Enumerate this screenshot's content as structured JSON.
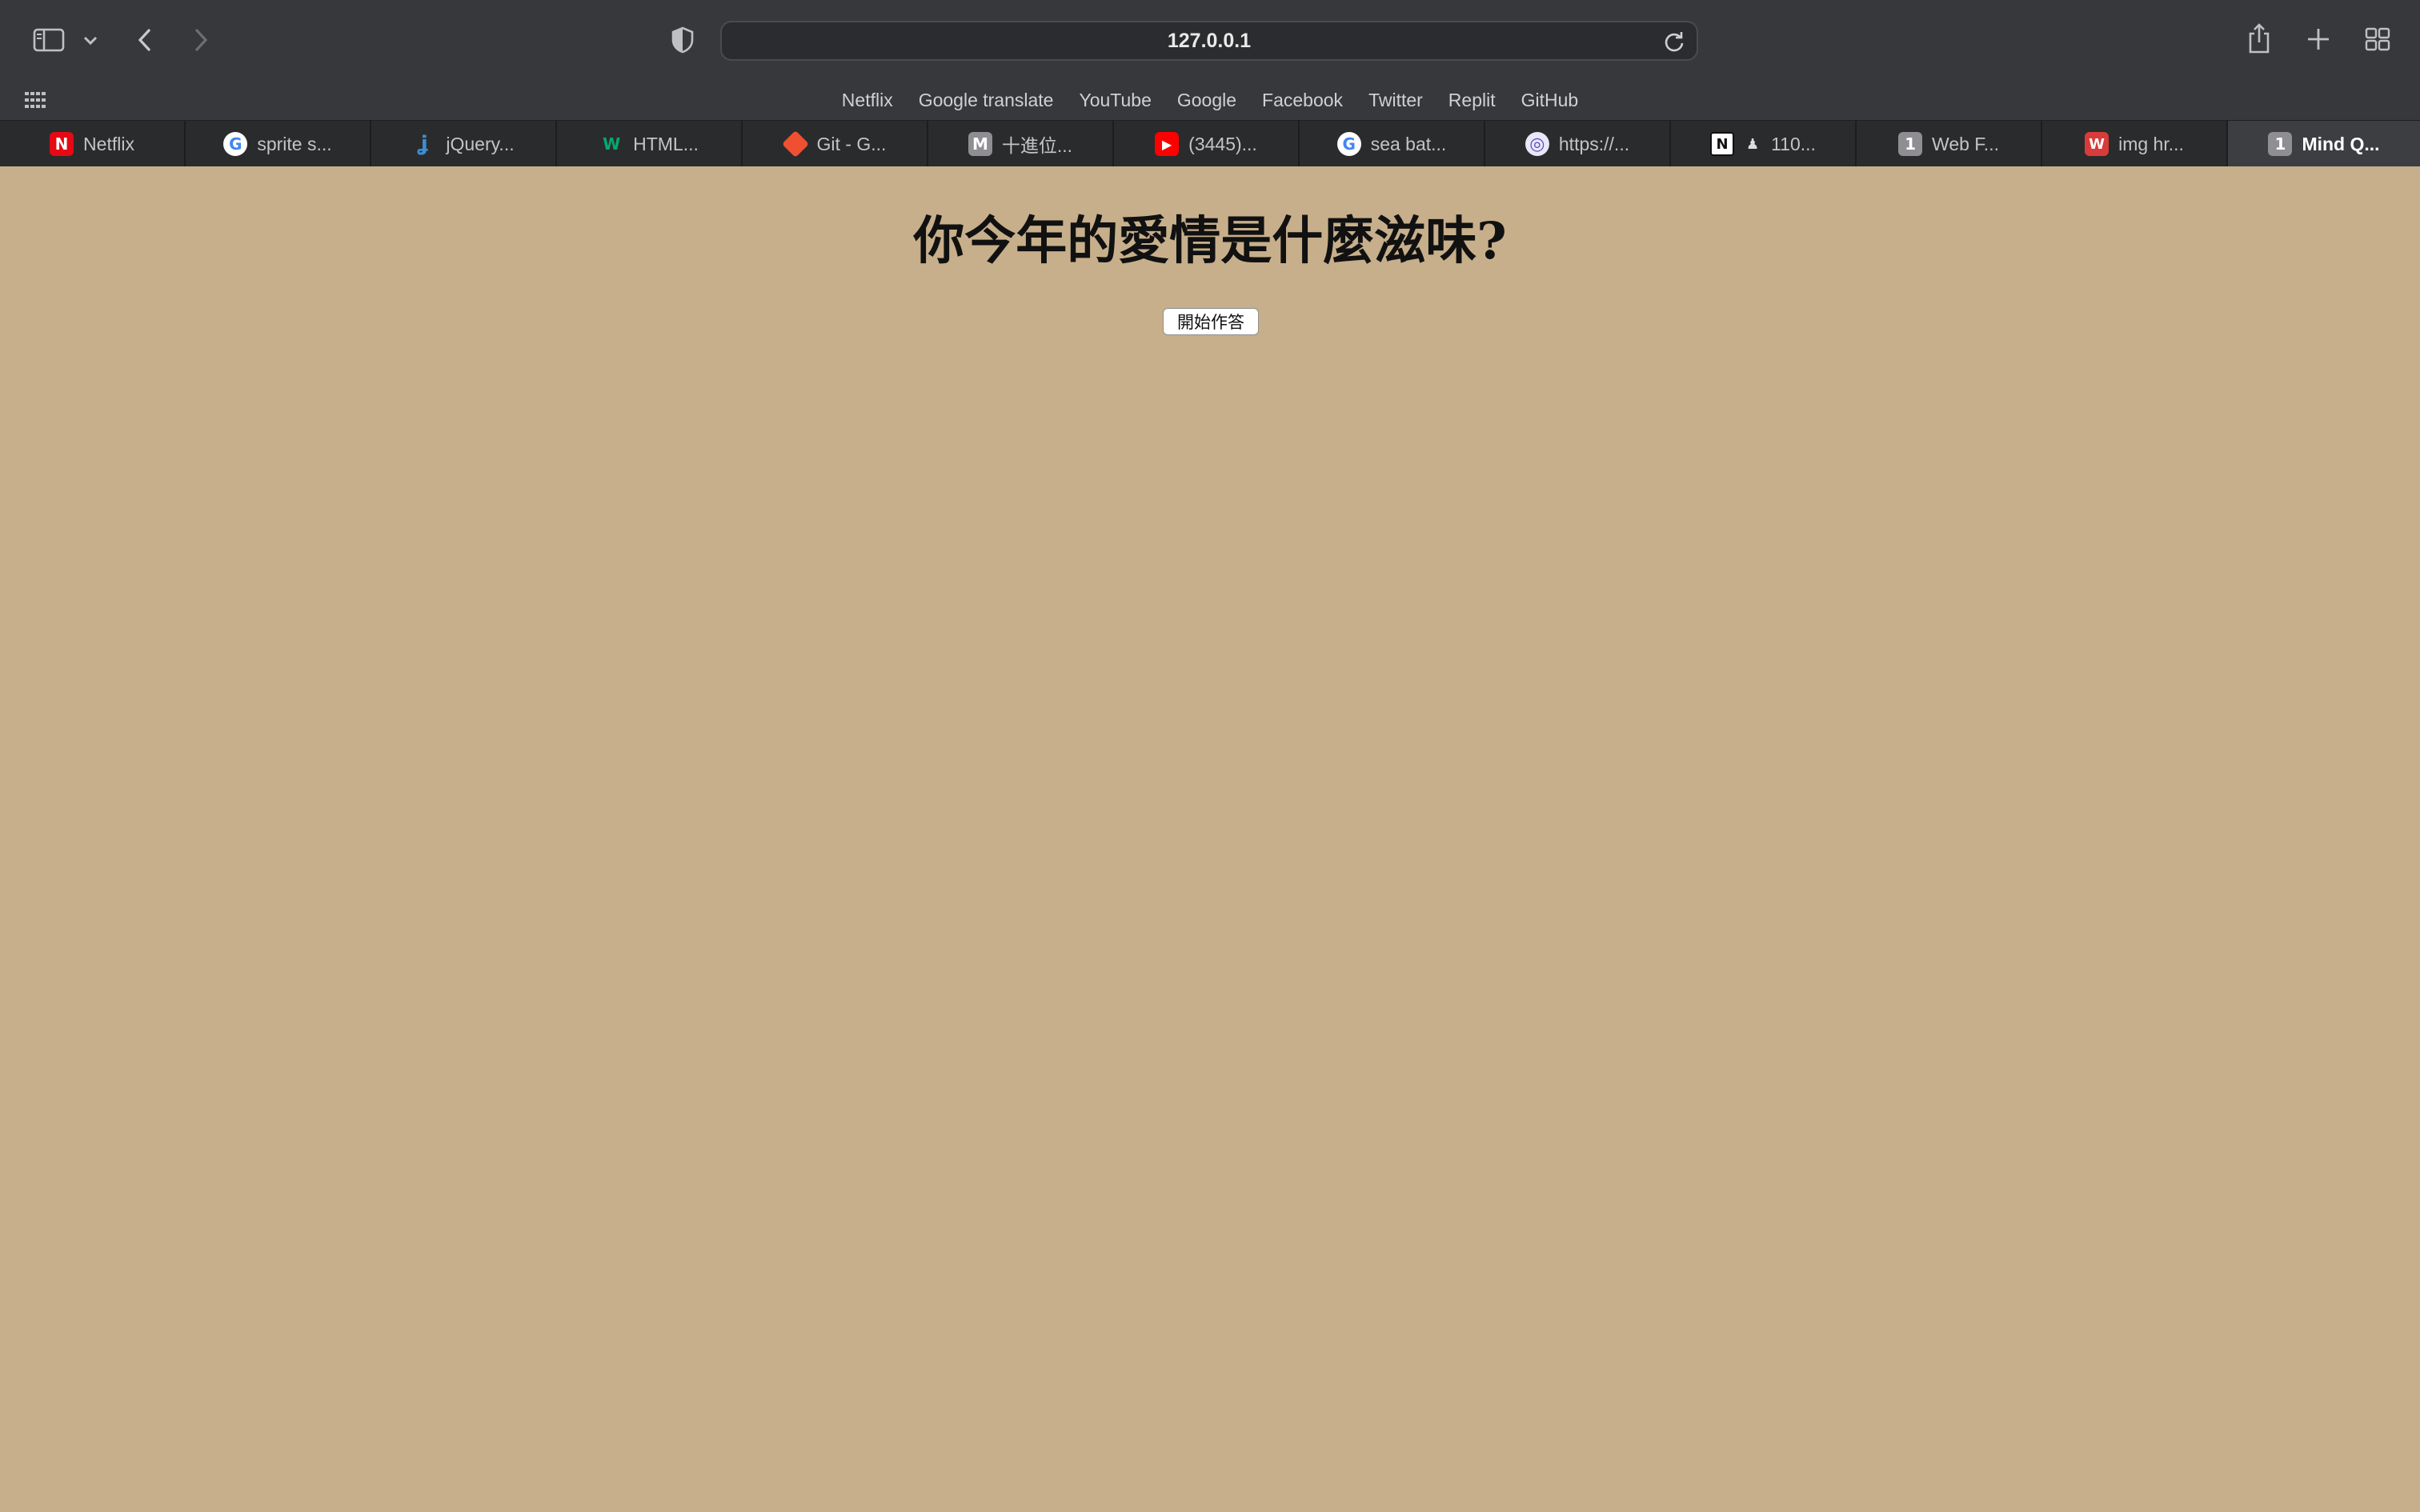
{
  "browser": {
    "address": "127.0.0.1",
    "favorites": [
      "Netflix",
      "Google translate",
      "YouTube",
      "Google",
      "Facebook",
      "Twitter",
      "Replit",
      "GitHub"
    ],
    "tabs": [
      {
        "label": "Netflix",
        "icon": "netflix-icon",
        "color": "#e50914",
        "glyph": "N"
      },
      {
        "label": "sprite s...",
        "icon": "google-icon",
        "color": "#ffffff",
        "glyph": "G"
      },
      {
        "label": "jQuery...",
        "icon": "jquery-icon",
        "color": "#2a2b2d",
        "glyph": "j"
      },
      {
        "label": "HTML...",
        "icon": "w3schools-icon",
        "color": "#2a2b2d",
        "glyph": "W"
      },
      {
        "label": "Git - G...",
        "icon": "git-icon",
        "color": "#f05032",
        "glyph": "◆"
      },
      {
        "label": "十進位...",
        "icon": "medium-icon",
        "color": "#8e8e93",
        "glyph": "M"
      },
      {
        "label": "(3445)...",
        "icon": "youtube-icon",
        "color": "#ff0000",
        "glyph": "▶"
      },
      {
        "label": "sea bat...",
        "icon": "google-icon",
        "color": "#ffffff",
        "glyph": "G"
      },
      {
        "label": "https://...",
        "icon": "globe-icon",
        "color": "#6b6df0",
        "glyph": "◎"
      },
      {
        "label": "110...",
        "icon": "notion-icon",
        "color": "#ffffff",
        "glyph": "N"
      },
      {
        "label": "Web F...",
        "icon": "number-one-icon",
        "color": "#8e8e93",
        "glyph": "1"
      },
      {
        "label": "img hr...",
        "icon": "w-red-icon",
        "color": "#d93b3b",
        "glyph": "W"
      },
      {
        "label": "Mind Q...",
        "icon": "number-one-icon",
        "color": "#8e8e93",
        "glyph": "1"
      }
    ]
  },
  "page": {
    "title": "你今年的愛情是什麼滋味?",
    "start_button": "開始作答"
  }
}
